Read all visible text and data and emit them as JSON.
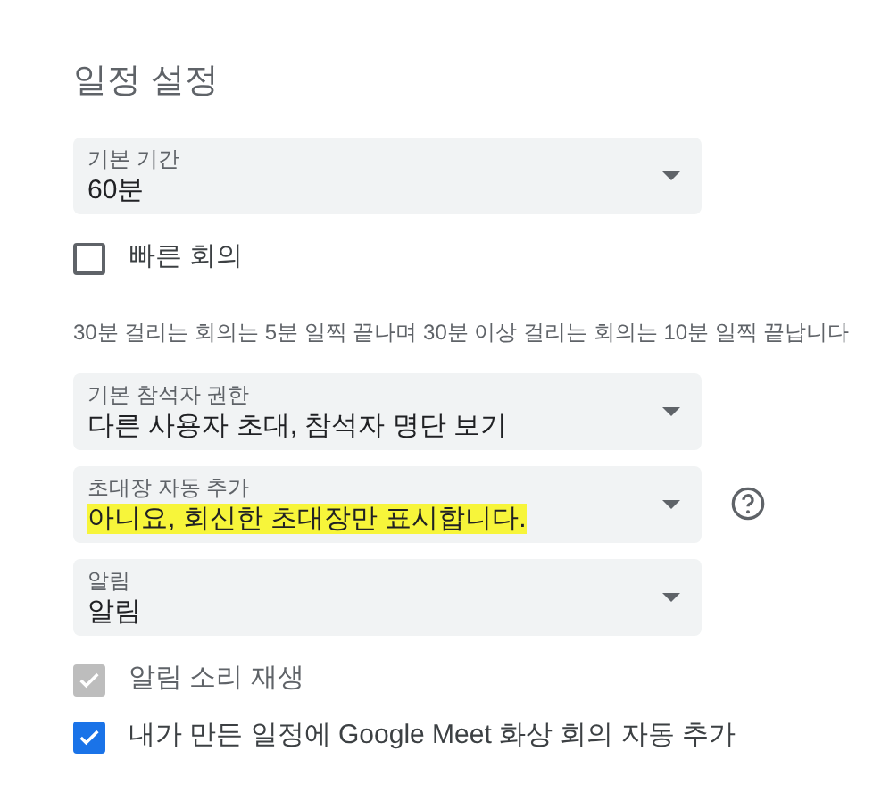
{
  "title": "일정 설정",
  "items": [
    {
      "kind": "select",
      "label": "기본 기간",
      "value": "60분",
      "help": false,
      "highlighted": false
    },
    {
      "kind": "checkbox",
      "label": "빠른 회의",
      "checked": false,
      "disabled": false
    },
    {
      "kind": "note",
      "text": "30분 걸리는 회의는 5분 일찍 끝나며 30분 이상 걸리는 회의는 10분 일찍 끝납니다"
    },
    {
      "kind": "select",
      "label": "기본 참석자 권한",
      "value": "다른 사용자 초대, 참석자 명단 보기",
      "help": false,
      "highlighted": false
    },
    {
      "kind": "select",
      "label": "초대장 자동 추가",
      "value": "아니요, 회신한 초대장만 표시합니다.",
      "help": true,
      "highlighted": true
    },
    {
      "kind": "select",
      "label": "알림",
      "value": "알림",
      "help": false,
      "highlighted": false
    },
    {
      "kind": "checkbox",
      "label": "알림 소리 재생",
      "checked": true,
      "disabled": true
    },
    {
      "kind": "checkbox",
      "label": "내가 만든 일정에 Google Meet 화상 회의 자동 추가",
      "checked": true,
      "disabled": false
    }
  ]
}
